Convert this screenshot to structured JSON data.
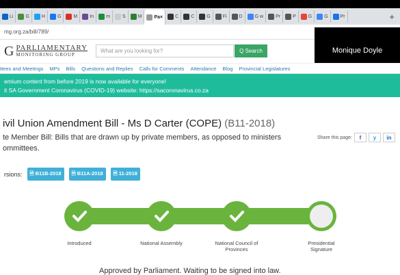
{
  "browser": {
    "tabs": [
      {
        "label": "Li",
        "color": "#0a66c2"
      },
      {
        "label": "G",
        "color": "#4a8f3c"
      },
      {
        "label": "H",
        "color": "#1da1f2"
      },
      {
        "label": "G",
        "color": "#1877f2"
      },
      {
        "label": "M",
        "color": "#d93025"
      },
      {
        "label": "In",
        "color": "#6a4c93"
      },
      {
        "label": "m",
        "color": "#1e8e3e"
      },
      {
        "label": "S",
        "color": "#cccccc"
      },
      {
        "label": "M",
        "color": "#2e7d32"
      },
      {
        "label": "Pa",
        "color": "#999999"
      },
      {
        "label": "C",
        "color": "#333333"
      },
      {
        "label": "C",
        "color": "#333333"
      },
      {
        "label": "G",
        "color": "#333333"
      },
      {
        "label": "Fi",
        "color": "#555555"
      },
      {
        "label": "D",
        "color": "#555555"
      },
      {
        "label": "G w",
        "color": "#4285f4"
      },
      {
        "label": "Pr",
        "color": "#555555"
      },
      {
        "label": "P",
        "color": "#555555"
      },
      {
        "label": "G",
        "color": "#ea4335"
      },
      {
        "label": "G",
        "color": "#4285f4"
      },
      {
        "label": "Pr",
        "color": "#1a73e8"
      }
    ],
    "active_tab_index": 9,
    "url": "mg.org.za/bill/789/"
  },
  "site": {
    "logo_initial": "G",
    "logo_line1": "PARLIAMENTARY",
    "logo_line2": "MONITORING GROUP",
    "search_placeholder": "What are you looking for?",
    "search_button": "Q Search",
    "nav": [
      "ttees and Meetings",
      "MPs",
      "Bills",
      "Questions and Replies",
      "Calls for Comments",
      "Attendance",
      "Blog",
      "Provincial Legislatures"
    ],
    "banner_line1": "emium content from before 2019 is now available for everyone!",
    "banner_line2": "it SA Government Coronavirus (COVID-19) website: https://sacoronavirus.co.za",
    "user_name": "Monique Doyle"
  },
  "bill": {
    "title": "ivil Union Amendment Bill - Ms D Carter (COPE)",
    "number": "(B11-2018)",
    "subtitle_line1": "te Member Bill: Bills that are drawn up by private members, as opposed to ministers",
    "subtitle_line2": "ommittees.",
    "share_label": "Share this page:",
    "share_buttons": [
      "f",
      "y",
      "in"
    ],
    "versions_label": "rsions:",
    "versions": [
      "B11B-2018",
      "B11A-2018",
      "11-2018"
    ],
    "stages": [
      {
        "label_line1": "Introduced",
        "label_line2": "",
        "done": true
      },
      {
        "label_line1": "National Assembly",
        "label_line2": "",
        "done": true
      },
      {
        "label_line1": "National Council of",
        "label_line2": "Provinces",
        "done": true
      },
      {
        "label_line1": "Presidential",
        "label_line2": "Signature",
        "done": false
      }
    ],
    "status": "Approved by Parliament. Waiting to be signed into law."
  },
  "colors": {
    "green": "#6ab43e",
    "teal": "#1fbc9c",
    "badge": "#41b0d8"
  }
}
